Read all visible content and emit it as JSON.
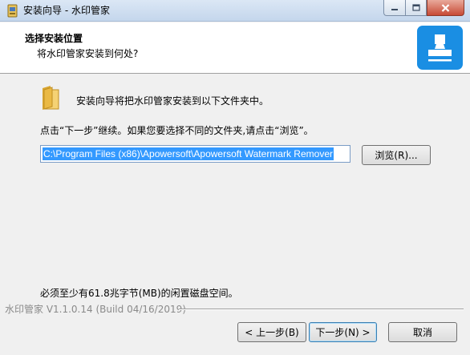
{
  "window": {
    "title": "安装向导 - 水印管家"
  },
  "header": {
    "title": "选择安装位置",
    "subtitle": "将水印管家安装到何处?"
  },
  "main": {
    "intro": "安装向导将把水印管家安装到以下文件夹中。",
    "hint": "点击“下一步”继续。如果您要选择不同的文件夹,请点击“浏览”。",
    "install_path": "C:\\Program Files (x86)\\Apowersoft\\Apowersoft Watermark Remover",
    "browse_label": "浏览(R)...",
    "disk_space": "必须至少有61.8兆字节(MB)的闲置磁盘空间。"
  },
  "footer": {
    "branding": "水印管家 V1.1.0.14  (Build 04/16/2019)",
    "back_label": "< 上一步(B)",
    "next_label": "下一步(N) >",
    "cancel_label": "取消"
  },
  "colors": {
    "accent": "#1a8ee3",
    "selection": "#3399ff",
    "close_button": "#c74b36"
  },
  "icons": {
    "title": "installer-icon",
    "logo": "stamp-icon",
    "folder": "folder-icon"
  }
}
